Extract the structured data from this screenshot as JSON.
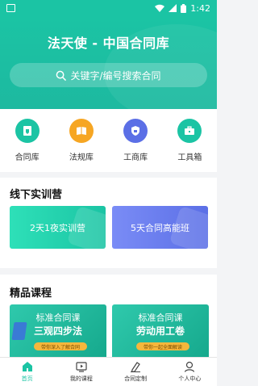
{
  "status_bar": {
    "time": "1:42"
  },
  "header": {
    "title": "法天使 - 中国合同库",
    "search_placeholder": "关键字/编号搜索合同"
  },
  "quick_links": [
    {
      "label": "合同库",
      "icon": "contract-icon",
      "color": "#1bc4a4"
    },
    {
      "label": "法规库",
      "icon": "book-icon",
      "color": "#f6a623"
    },
    {
      "label": "工商库",
      "icon": "shield-icon",
      "color": "#5b6fe6"
    },
    {
      "label": "工具箱",
      "icon": "toolbox-icon",
      "color": "#1bc4a4"
    }
  ],
  "training": {
    "title": "线下实训营",
    "cards": [
      {
        "label": "2天1夜实训营"
      },
      {
        "label": "5天合同高能班"
      }
    ]
  },
  "courses": {
    "title": "精品课程",
    "cards": [
      {
        "line1": "标准合同课",
        "line2": "三观四步法",
        "tag": "带你深入了解合同"
      },
      {
        "line1": "标准合同课",
        "line2": "劳动用工卷",
        "tag": "带你一起全面解读"
      }
    ]
  },
  "tabbar": [
    {
      "label": "首页",
      "icon": "home-icon",
      "active": true
    },
    {
      "label": "我的课程",
      "icon": "play-icon",
      "active": false
    },
    {
      "label": "合同定制",
      "icon": "pen-icon",
      "active": false
    },
    {
      "label": "个人中心",
      "icon": "user-icon",
      "active": false
    }
  ]
}
